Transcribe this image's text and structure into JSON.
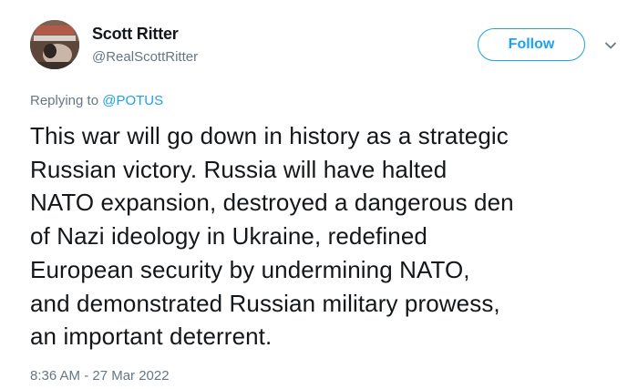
{
  "author": {
    "name": "Scott Ritter",
    "handle": "@RealScottRitter"
  },
  "follow_button": {
    "label": "Follow"
  },
  "menu": {
    "icon": "chevron-down-icon"
  },
  "reply": {
    "prefix": "Replying to ",
    "mention": "@POTUS"
  },
  "tweet": {
    "lines": [
      "This war will go down in history as a strategic",
      "Russian victory. Russia will have halted",
      "NATO expansion, destroyed a dangerous den",
      "of Nazi ideology in Ukraine, redefined",
      "European security by undermining NATO,",
      "and demonstrated Russian military prowess,",
      "an important deterrent."
    ],
    "timestamp": "8:36 AM - 27 Mar 2022"
  },
  "colors": {
    "accent": "#1da1f2",
    "text": "#14171a",
    "muted": "#657786"
  }
}
